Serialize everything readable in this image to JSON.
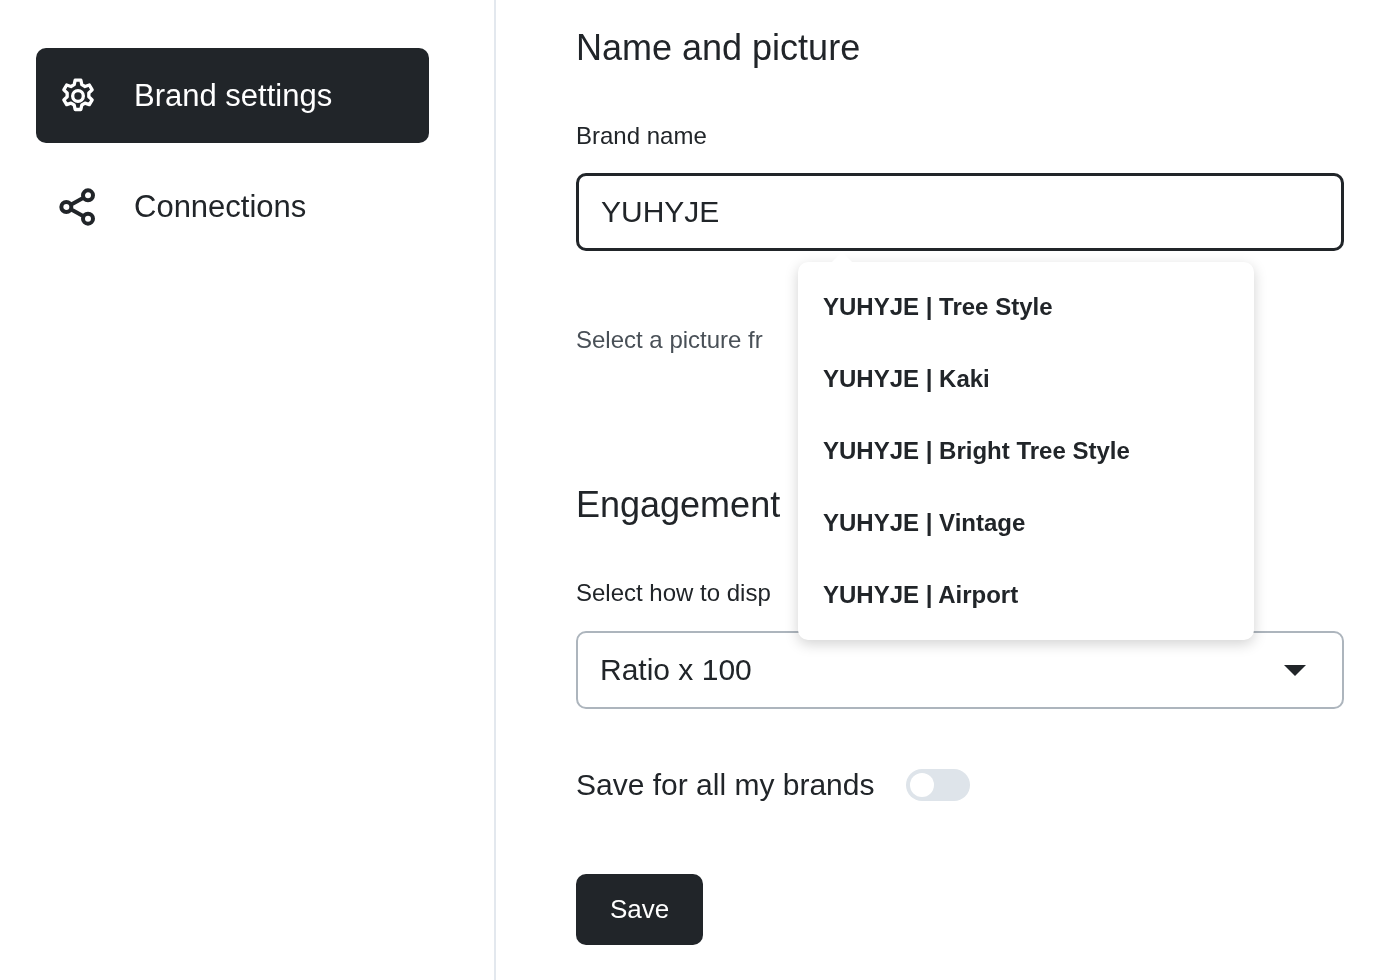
{
  "sidebar": {
    "items": [
      {
        "label": "Brand settings",
        "kind": "settings",
        "selected": true
      },
      {
        "label": "Connections",
        "kind": "connections",
        "selected": false
      }
    ]
  },
  "name_section": {
    "title": "Name and picture",
    "brand_name": {
      "label": "Brand name",
      "value": "YUHYJE"
    },
    "suggestions": [
      "YUHYJE | Tree Style",
      "YUHYJE | Kaki",
      "YUHYJE | Bright Tree Style",
      "YUHYJE | Vintage",
      "YUHYJE | Airport"
    ],
    "picture_hint": "Select a picture fr"
  },
  "engagement_section": {
    "title": "Engagement",
    "display_label": "Select how to disp",
    "display_select": {
      "value": "Ratio x 100"
    },
    "save_all": {
      "label": "Save for all my brands",
      "on": false
    },
    "save_button": "Save"
  }
}
